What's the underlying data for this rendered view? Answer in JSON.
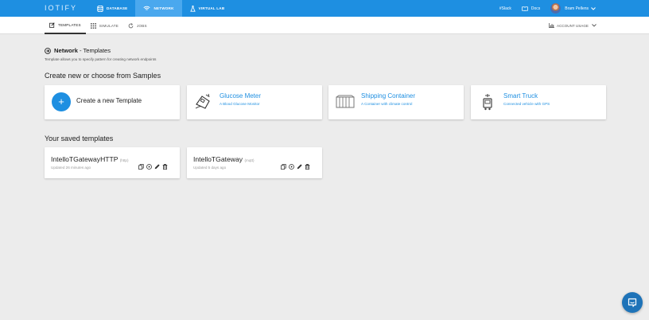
{
  "app": {
    "logo": "IOTIFY"
  },
  "topnav": [
    {
      "label": "DATABASE",
      "icon": "database-icon",
      "active": false
    },
    {
      "label": "NETWORK",
      "icon": "wifi-icon",
      "active": true
    },
    {
      "label": "VIRTUAL LAB",
      "icon": "flask-icon",
      "active": false
    }
  ],
  "topright": {
    "slack": "#Slack",
    "docs": "Docs",
    "user": "Bram Pellens"
  },
  "subtabs": [
    {
      "label": "TEMPLATES",
      "icon": "edit-icon",
      "active": true
    },
    {
      "label": "SIMULATE",
      "icon": "grid-icon",
      "active": false
    },
    {
      "label": "JOBS",
      "icon": "refresh-icon",
      "active": false
    }
  ],
  "account_usage": "ACCOUNT USAGE",
  "page": {
    "title_bold": "Network",
    "title_rest": "- Templates",
    "description": "Template allows you to specify pattern for creating network endpoints",
    "samples_heading": "Create new or choose from Samples",
    "saved_heading": "Your saved templates"
  },
  "new_template": {
    "label": "Create a new Template"
  },
  "samples": [
    {
      "title": "Glucose Meter",
      "subtitle": "A Blood Glucose Monitor",
      "icon": "glucose-meter-icon"
    },
    {
      "title": "Shipping Container",
      "subtitle": "A Container with climate control",
      "icon": "shipping-container-icon"
    },
    {
      "title": "Smart Truck",
      "subtitle": "Connected vehicle with GPS",
      "icon": "truck-icon"
    }
  ],
  "saved": [
    {
      "name": "IntelloTGatewayHTTP",
      "proto": "(http)",
      "updated": "Updated 26 minutes ago"
    },
    {
      "name": "IntelloTGateway",
      "proto": "(mqtt)",
      "updated": "Updated 5 days ago"
    }
  ],
  "colors": {
    "primary": "#1e8fe1",
    "background": "#ececec"
  }
}
